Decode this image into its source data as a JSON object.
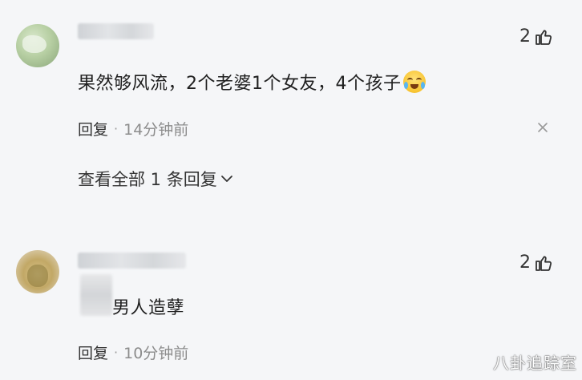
{
  "comments": [
    {
      "text": "果然够风流，2个老婆1个女友，4个孩子",
      "emoji_icon": "crying-laughing-emoji",
      "likes": "2",
      "reply_label": "回复",
      "separator": "·",
      "time": "14分钟前",
      "view_replies": "查看全部 1 条回复"
    },
    {
      "text": "男人造孽",
      "likes": "2",
      "reply_label": "回复",
      "separator": "·",
      "time": "10分钟前"
    }
  ],
  "watermark": "八卦追踪室"
}
